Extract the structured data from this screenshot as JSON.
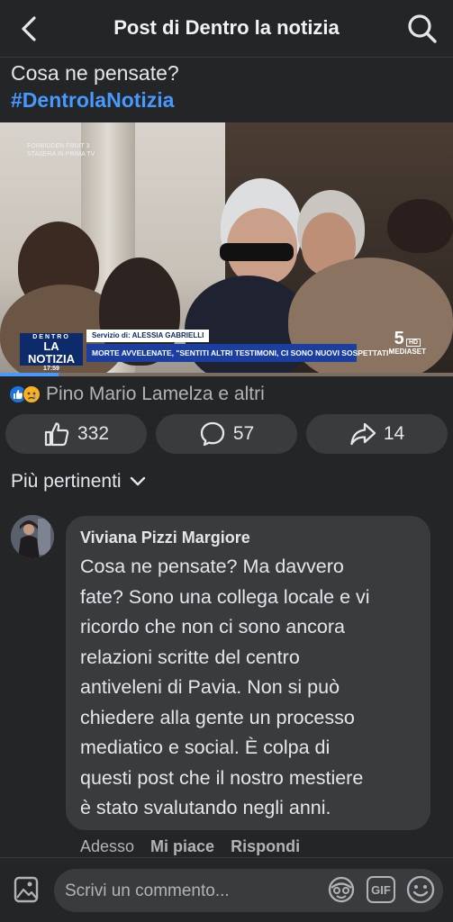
{
  "header": {
    "title": "Post di Dentro la notizia",
    "back_icon": "chevron-left-icon",
    "search_icon": "search-icon"
  },
  "post": {
    "text": "Cosa ne pensate?",
    "hashtag": "#DentrolaNotizia"
  },
  "video": {
    "overlay_tag": "FORBIDDEN FRUIT 3\nSTASERA IN PRIMA TV",
    "program_logo_top": "DENTRO",
    "program_logo_main": "LA NOTIZIA",
    "time": "17:59",
    "service_label": "Servizio di:",
    "service_author": "ALESSIA GABRIELLI",
    "headline": "MORTE AVVELENATE, \"SENTITI ALTRI TESTIMONI, CI SONO NUOVI SOSPETTATI\"",
    "channel_number": "5",
    "channel_hd": "HD",
    "channel_name": "MEDIASET",
    "progress": 0.13
  },
  "reactions": {
    "text": "Pino Mario Lamelza e altri",
    "icons": [
      "like-reaction-icon",
      "sad-reaction-icon"
    ]
  },
  "actions": {
    "like_count": "332",
    "comment_count": "57",
    "share_count": "14"
  },
  "sort": {
    "label": "Più pertinenti"
  },
  "comment": {
    "author": "Viviana Pizzi Margiore",
    "text": "Cosa ne pensate? Ma davvero\nfate? Sono una collega locale e vi\nricordo che non ci sono ancora\nrelazioni scritte del  centro\nantiveleni di Pavia. Non si può\nchiedere alla gente un processo\nmediatico e social. È colpa di\nquesti post che il nostro mestiere\nè stato svalutando negli anni.",
    "time": "Adesso",
    "like_label": "Mi piace",
    "reply_label": "Rispondi"
  },
  "composer": {
    "placeholder": "Scrivi un commento...",
    "gif_label": "GIF"
  },
  "colors": {
    "background": "#242526",
    "surface": "#3a3b3c",
    "accent": "#4599ff",
    "text": "#e4e6eb",
    "muted": "#b0b3b8"
  }
}
